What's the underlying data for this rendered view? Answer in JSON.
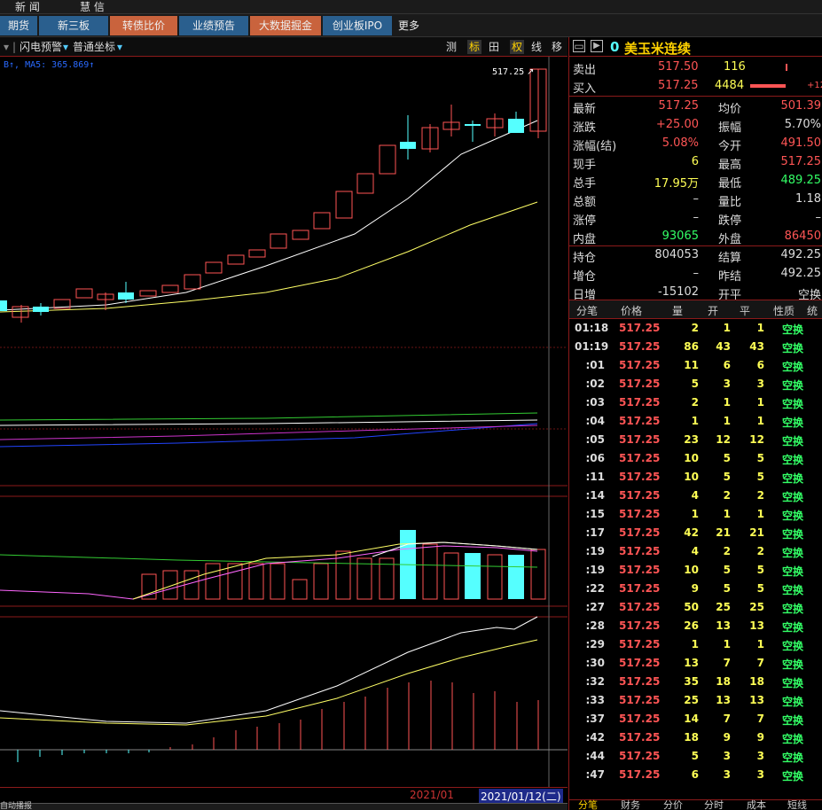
{
  "top_nav": {
    "item1": "新 闻",
    "item2": "慧 信"
  },
  "toolbar": {
    "buttons": [
      "期货",
      "新三板",
      "转债比价",
      "业绩预告",
      "大数据掘金",
      "创业板IPO",
      "更多"
    ]
  },
  "chart_header": {
    "flash_alert": "闪电预警",
    "coord_mode": "普通坐标",
    "tools": [
      "测",
      "标",
      "田",
      "权",
      "线",
      "移"
    ],
    "ma_legend": "B↑, MA5: 365.869↑"
  },
  "chart": {
    "last_price_label": "517.25",
    "date_left": "2021/01",
    "date_right": "2021/01/12(二)"
  },
  "quote": {
    "title_code": "0",
    "title_name": "美玉米连续",
    "sell": {
      "label": "卖出",
      "price": "517.50",
      "vol": "116"
    },
    "buy": {
      "label": "买入",
      "price": "517.25",
      "vol": "4484",
      "extra": "+12"
    },
    "rows": [
      {
        "l1": "最新",
        "v1": "517.25",
        "l2": "均价",
        "v2": "501.39",
        "c1": "#ff5555",
        "c2": "#ff5555"
      },
      {
        "l1": "涨跌",
        "v1": "+25.00",
        "l2": "振幅",
        "v2": "5.70%",
        "c1": "#ff5555",
        "c2": "#dddddd"
      },
      {
        "l1": "涨幅(结)",
        "v1": "5.08%",
        "l2": "今开",
        "v2": "491.50",
        "c1": "#ff5555",
        "c2": "#ff5555"
      },
      {
        "l1": "现手",
        "v1": "6",
        "l2": "最高",
        "v2": "517.25",
        "c1": "#ffff55",
        "c2": "#ff5555"
      },
      {
        "l1": "总手",
        "v1": "17.95万",
        "l2": "最低",
        "v2": "489.25",
        "c1": "#ffff55",
        "c2": "#33ff66"
      },
      {
        "l1": "总额",
        "v1": "–",
        "l2": "量比",
        "v2": "1.18",
        "c1": "#dddddd",
        "c2": "#dddddd"
      },
      {
        "l1": "涨停",
        "v1": "–",
        "l2": "跌停",
        "v2": "–",
        "c1": "#dddddd",
        "c2": "#dddddd"
      },
      {
        "l1": "内盘",
        "v1": "93065",
        "l2": "外盘",
        "v2": "86450",
        "c1": "#33ff66",
        "c2": "#ff5555"
      },
      {
        "l1": "持仓",
        "v1": "804053",
        "l2": "结算",
        "v2": "492.25",
        "c1": "#dddddd",
        "c2": "#dddddd"
      },
      {
        "l1": "增仓",
        "v1": "–",
        "l2": "昨结",
        "v2": "492.25",
        "c1": "#dddddd",
        "c2": "#dddddd"
      },
      {
        "l1": "日增",
        "v1": "-15102",
        "l2": "开平",
        "v2": "空换",
        "c1": "#dddddd",
        "c2": "#dddddd"
      }
    ]
  },
  "ticks": {
    "headers": [
      "分笔",
      "价格",
      "量",
      "开",
      "平",
      "性质",
      "统"
    ],
    "rows": [
      {
        "t": "01:18",
        "p": "517.25",
        "v": "2",
        "o": "1",
        "c": "1",
        "k": "空换"
      },
      {
        "t": "01:19",
        "p": "517.25",
        "v": "86",
        "o": "43",
        "c": "43",
        "k": "空换"
      },
      {
        "t": ":01",
        "p": "517.25",
        "v": "11",
        "o": "6",
        "c": "6",
        "k": "空换"
      },
      {
        "t": ":02",
        "p": "517.25",
        "v": "5",
        "o": "3",
        "c": "3",
        "k": "空换"
      },
      {
        "t": ":03",
        "p": "517.25",
        "v": "2",
        "o": "1",
        "c": "1",
        "k": "空换"
      },
      {
        "t": ":04",
        "p": "517.25",
        "v": "1",
        "o": "1",
        "c": "1",
        "k": "空换"
      },
      {
        "t": ":05",
        "p": "517.25",
        "v": "23",
        "o": "12",
        "c": "12",
        "k": "空换"
      },
      {
        "t": ":06",
        "p": "517.25",
        "v": "10",
        "o": "5",
        "c": "5",
        "k": "空换"
      },
      {
        "t": ":11",
        "p": "517.25",
        "v": "10",
        "o": "5",
        "c": "5",
        "k": "空换"
      },
      {
        "t": ":14",
        "p": "517.25",
        "v": "4",
        "o": "2",
        "c": "2",
        "k": "空换"
      },
      {
        "t": ":15",
        "p": "517.25",
        "v": "1",
        "o": "1",
        "c": "1",
        "k": "空换"
      },
      {
        "t": ":17",
        "p": "517.25",
        "v": "42",
        "o": "21",
        "c": "21",
        "k": "空换"
      },
      {
        "t": ":19",
        "p": "517.25",
        "v": "4",
        "o": "2",
        "c": "2",
        "k": "空换"
      },
      {
        "t": ":19",
        "p": "517.25",
        "v": "10",
        "o": "5",
        "c": "5",
        "k": "空换"
      },
      {
        "t": ":22",
        "p": "517.25",
        "v": "9",
        "o": "5",
        "c": "5",
        "k": "空换"
      },
      {
        "t": ":27",
        "p": "517.25",
        "v": "50",
        "o": "25",
        "c": "25",
        "k": "空换"
      },
      {
        "t": ":28",
        "p": "517.25",
        "v": "26",
        "o": "13",
        "c": "13",
        "k": "空换"
      },
      {
        "t": ":29",
        "p": "517.25",
        "v": "1",
        "o": "1",
        "c": "1",
        "k": "空换"
      },
      {
        "t": ":30",
        "p": "517.25",
        "v": "13",
        "o": "7",
        "c": "7",
        "k": "空换"
      },
      {
        "t": ":32",
        "p": "517.25",
        "v": "35",
        "o": "18",
        "c": "18",
        "k": "空换"
      },
      {
        "t": ":33",
        "p": "517.25",
        "v": "25",
        "o": "13",
        "c": "13",
        "k": "空换"
      },
      {
        "t": ":37",
        "p": "517.25",
        "v": "14",
        "o": "7",
        "c": "7",
        "k": "空换"
      },
      {
        "t": ":42",
        "p": "517.25",
        "v": "18",
        "o": "9",
        "c": "9",
        "k": "空换"
      },
      {
        "t": ":44",
        "p": "517.25",
        "v": "5",
        "o": "3",
        "c": "3",
        "k": "空换"
      },
      {
        "t": ":47",
        "p": "517.25",
        "v": "6",
        "o": "3",
        "c": "3",
        "k": "空换"
      }
    ]
  },
  "bottom_tabs": [
    "分笔",
    "财务",
    "分价",
    "分时",
    "成本",
    "短线"
  ],
  "bottom_left_tab": "自动播报",
  "colors": {
    "up": "#ff5555",
    "down": "#55ffff",
    "frame": "#8b1a1a",
    "accent": "#ffd200"
  }
}
